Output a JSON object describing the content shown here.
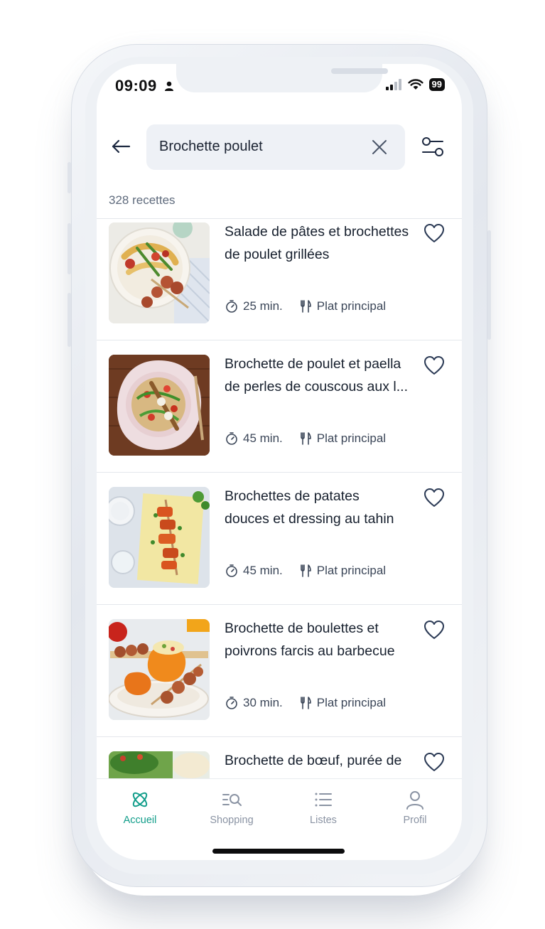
{
  "status_bar": {
    "time": "09:09",
    "battery": "99"
  },
  "search": {
    "query": "Brochette poulet"
  },
  "results": {
    "count": "328 recettes"
  },
  "recipes": [
    {
      "title_line1": "Salade de pâtes et brochettes",
      "title_line2": "de poulet grillées",
      "time": "25 min.",
      "category": "Plat principal",
      "favorited": false
    },
    {
      "title_line1": "Brochette de poulet et paella",
      "title_line2": "de perles de couscous aux l...",
      "time": "45 min.",
      "category": "Plat principal",
      "favorited": false
    },
    {
      "title_line1": "Brochettes de patates",
      "title_line2": "douces et dressing au tahin",
      "time": "45 min.",
      "category": "Plat principal",
      "favorited": false
    },
    {
      "title_line1": "Brochette de boulettes et",
      "title_line2": "poivrons farcis au barbecue",
      "time": "30 min.",
      "category": "Plat principal",
      "favorited": false
    },
    {
      "title_line1": "Brochette de bœuf, purée de",
      "title_line2": "",
      "time": "",
      "category": "",
      "favorited": false
    }
  ],
  "bottom_nav": [
    {
      "label": "Accueil",
      "icon": "atom-icon",
      "active": true
    },
    {
      "label": "Shopping",
      "icon": "search-list-icon",
      "active": false
    },
    {
      "label": "Listes",
      "icon": "list-icon",
      "active": false
    },
    {
      "label": "Profil",
      "icon": "user-icon",
      "active": false
    }
  ],
  "colors": {
    "accent": "#119d8a",
    "text_primary": "#17202e",
    "text_secondary": "#5f6b7d",
    "search_bg": "#eef1f6"
  }
}
